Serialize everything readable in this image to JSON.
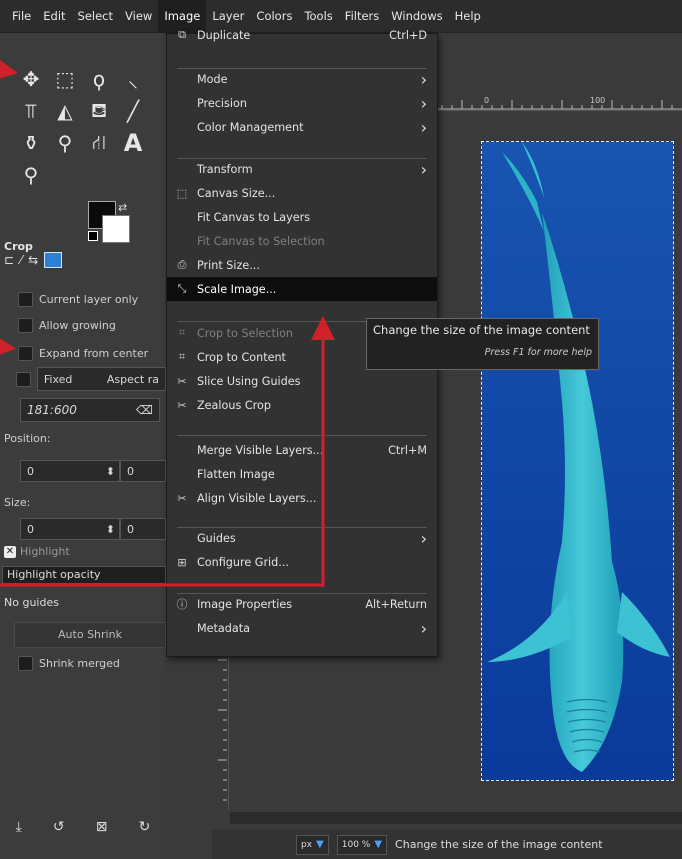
{
  "menubar": [
    "File",
    "Edit",
    "Select",
    "View",
    "Image",
    "Layer",
    "Colors",
    "Tools",
    "Filters",
    "Windows",
    "Help"
  ],
  "active_menu": "Image",
  "image_menu": [
    {
      "icon": "duplicate-icon",
      "glyph": "⧉",
      "label": "Duplicate",
      "shortcut": "Ctrl+D"
    },
    {
      "icon": "",
      "glyph": "",
      "label": "Mode",
      "submenu": true
    },
    {
      "icon": "",
      "glyph": "",
      "label": "Precision",
      "submenu": true
    },
    {
      "icon": "",
      "glyph": "",
      "label": "Color Management",
      "submenu": true
    },
    {
      "icon": "",
      "glyph": "",
      "label": "Transform",
      "submenu": true
    },
    {
      "icon": "canvas-size-icon",
      "glyph": "⬚",
      "label": "Canvas Size..."
    },
    {
      "icon": "",
      "glyph": "",
      "label": "Fit Canvas to Layers"
    },
    {
      "icon": "",
      "glyph": "",
      "label": "Fit Canvas to Selection",
      "disabled": true
    },
    {
      "icon": "print-size-icon",
      "glyph": "⎙",
      "label": "Print Size..."
    },
    {
      "icon": "scale-image-icon",
      "glyph": "⤡",
      "label": "Scale Image...",
      "highlighted": true
    },
    {
      "icon": "crop-icon",
      "glyph": "⌗",
      "label": "Crop to Selection",
      "disabled": true
    },
    {
      "icon": "crop-icon",
      "glyph": "⌗",
      "label": "Crop to Content"
    },
    {
      "icon": "slice-icon",
      "glyph": "✂",
      "label": "Slice Using Guides"
    },
    {
      "icon": "zealous-icon",
      "glyph": "✂",
      "label": "Zealous Crop"
    },
    {
      "icon": "",
      "glyph": "",
      "label": "Merge Visible Layers...",
      "shortcut": "Ctrl+M"
    },
    {
      "icon": "",
      "glyph": "",
      "label": "Flatten Image"
    },
    {
      "icon": "align-icon",
      "glyph": "✂",
      "label": "Align Visible Layers..."
    },
    {
      "icon": "",
      "glyph": "",
      "label": "Guides",
      "submenu": true
    },
    {
      "icon": "grid-icon",
      "glyph": "⊞",
      "label": "Configure Grid..."
    },
    {
      "icon": "info-icon",
      "glyph": "ⓘ",
      "label": "Image Properties",
      "shortcut": "Alt+Return"
    },
    {
      "icon": "",
      "glyph": "",
      "label": "Metadata",
      "submenu": true
    }
  ],
  "tooltip": {
    "title": "Change the size of the image content",
    "hint": "Press F1 for more help"
  },
  "tool_options": {
    "title": "Crop",
    "current_layer_only": "Current layer only",
    "allow_growing": "Allow growing",
    "expand_from_center": "Expand from center",
    "fixed": "Fixed",
    "aspect": "Aspect ra",
    "ratio": "181:600",
    "position_label": "Position:",
    "position_x": "0",
    "position_y": "0",
    "size_label": "Size:",
    "size_w": "0",
    "size_h": "0",
    "highlight": "Highlight",
    "highlight_opacity": "Highlight opacity",
    "guides": "No guides",
    "auto_shrink": "Auto Shrink",
    "shrink_merged": "Shrink merged"
  },
  "ruler": {
    "t0": "0",
    "t100": "100"
  },
  "status": {
    "unit": "px",
    "zoom": "100 %",
    "message": "Change the size of the image content"
  },
  "colors": {
    "accent_red": "#d0202a",
    "image_blue": "#0d3b86",
    "menu_bg": "#323232"
  }
}
